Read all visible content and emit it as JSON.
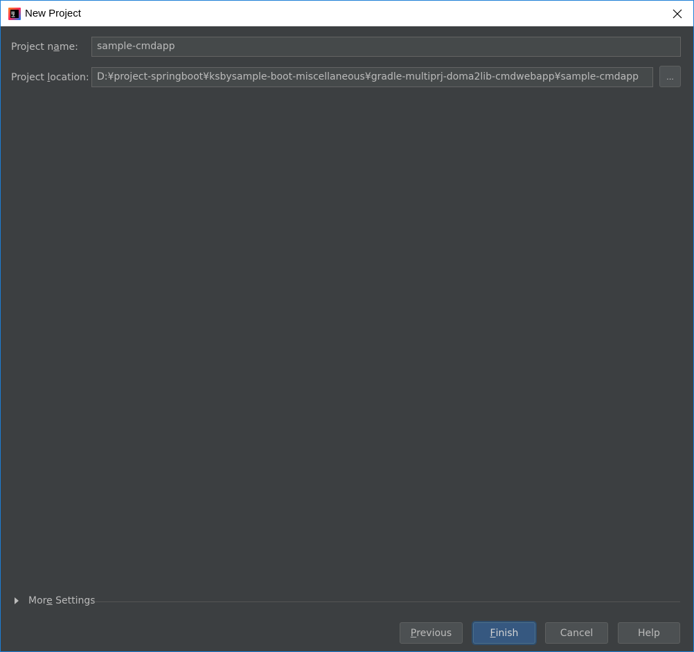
{
  "window": {
    "title": "New Project",
    "close_icon": "close-icon",
    "app_icon": "intellij-idea-icon"
  },
  "form": {
    "project_name": {
      "label_pre": "Project n",
      "label_mnemonic": "a",
      "label_post": "me:",
      "value": "sample-cmdapp"
    },
    "project_location": {
      "label_pre": "Project ",
      "label_mnemonic": "l",
      "label_post": "ocation:",
      "value": "D:¥project-springboot¥ksbysample-boot-miscellaneous¥gradle-multiprj-doma2lib-cmdwebapp¥sample-cmdapp",
      "browse_label": "..."
    }
  },
  "more_settings": {
    "label_pre": "Mor",
    "label_mnemonic": "e",
    "label_post": " Settings",
    "icon": "triangle-right-icon"
  },
  "buttons": {
    "previous": {
      "mnemonic": "P",
      "rest": "revious"
    },
    "finish": {
      "mnemonic": "F",
      "rest": "inish"
    },
    "cancel": {
      "label": "Cancel"
    },
    "help": {
      "label": "Help"
    }
  },
  "colors": {
    "background": "#3c3f41",
    "field_background": "#45494a",
    "text": "#bbbbbb",
    "primary_button": "#365880",
    "window_border": "#1c7ed6"
  }
}
